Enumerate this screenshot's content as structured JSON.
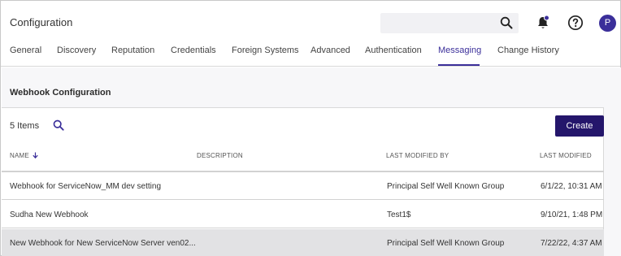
{
  "header": {
    "title": "Configuration",
    "search_placeholder": "",
    "avatar_initial": "P"
  },
  "tabs": [
    {
      "label": "General"
    },
    {
      "label": "Discovery"
    },
    {
      "label": "Reputation"
    },
    {
      "label": "Credentials"
    },
    {
      "label": "Foreign Systems"
    },
    {
      "label": "Advanced"
    },
    {
      "label": "Authentication"
    },
    {
      "label": "Messaging",
      "active": true
    },
    {
      "label": "Change History"
    }
  ],
  "section": {
    "title": "Webhook Configuration",
    "items_count": "5 Items",
    "create_label": "Create"
  },
  "table": {
    "columns": [
      "NAME",
      "DESCRIPTION",
      "LAST MODIFIED BY",
      "LAST MODIFIED"
    ],
    "rows": [
      {
        "name": "Webhook for ServiceNow_MM dev setting",
        "description": "",
        "modified_by": "Principal Self Well Known Group",
        "modified": "6/1/22, 10:31 AM"
      },
      {
        "name": "Sudha New Webhook",
        "description": "",
        "modified_by": "Test1$",
        "modified": "9/10/21, 1:48 PM"
      },
      {
        "name": "New Webhook for New ServiceNow Server ven02...",
        "description": "",
        "modified_by": "Principal Self Well Known Group",
        "modified": "7/22/22, 4:37 AM"
      }
    ]
  },
  "colors": {
    "accent": "#3b2f9a",
    "button": "#24166b",
    "selected_row": "#e2e2e4"
  }
}
